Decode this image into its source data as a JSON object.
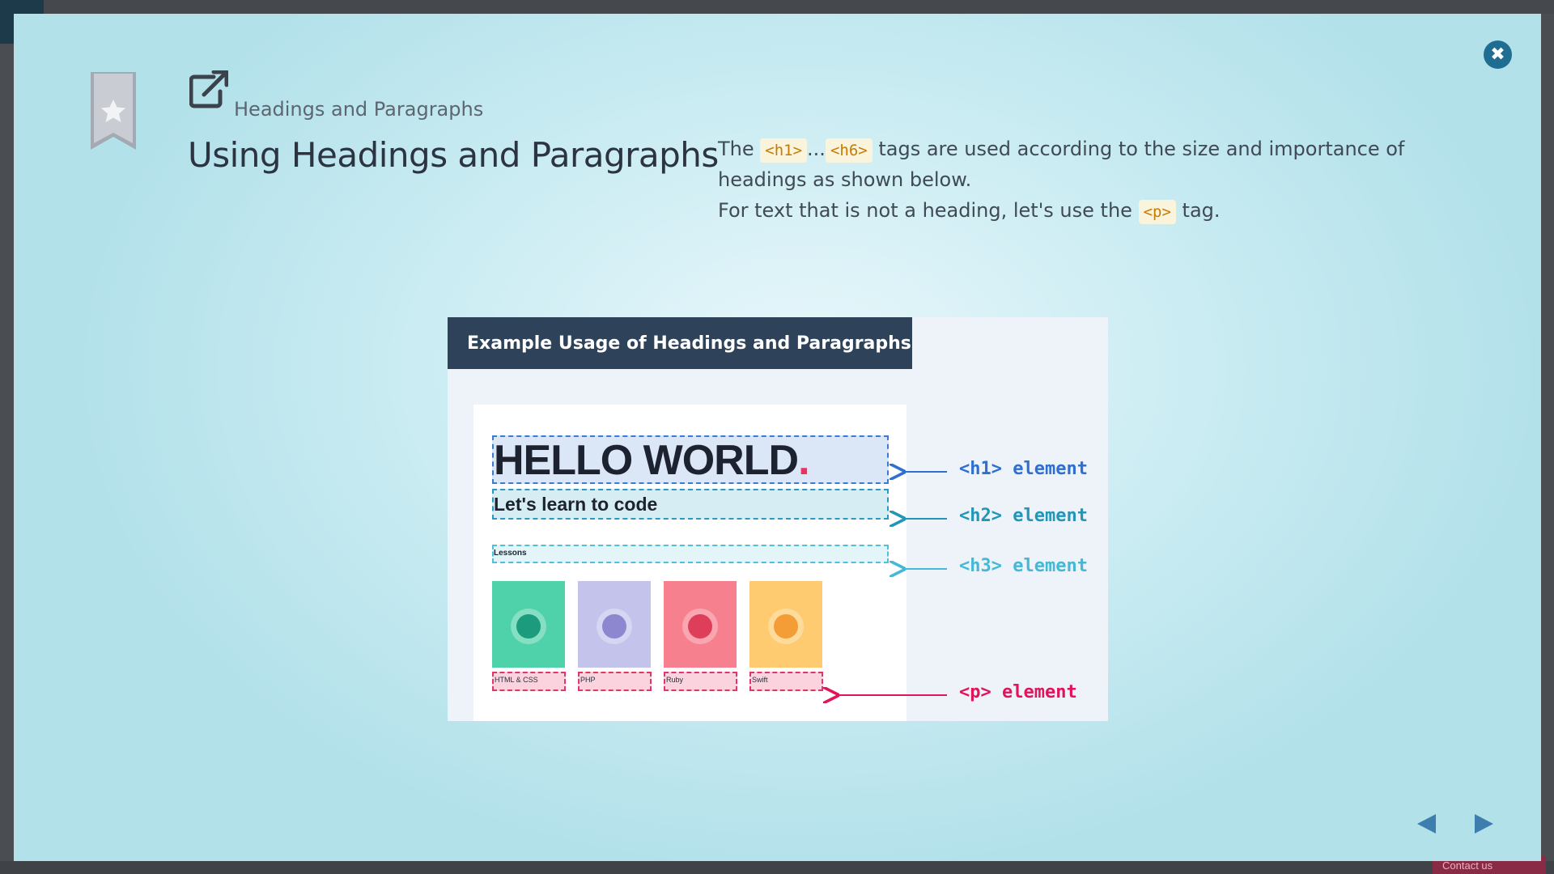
{
  "window": {
    "contact_label": "Contact us"
  },
  "modal": {
    "breadcrumb": "Headings and Paragraphs",
    "title": "Using Headings and Paragraphs",
    "description": {
      "line1_prefix": "The",
      "tag_h1": "<h1>",
      "ellipsis": "...",
      "tag_h6": "<h6>",
      "line1_suffix": "tags are used according to the size and importance of headings as shown below.",
      "line2_prefix": "For text that is not a heading, let's use the",
      "tag_p": "<p>",
      "line2_suffix": "tag."
    },
    "icons": {
      "bookmark": "bookmark-star-icon",
      "external": "external-link-icon",
      "close": "close-icon",
      "prev": "triangle-left-icon",
      "next": "triangle-right-icon"
    }
  },
  "example": {
    "header": "Example Usage of Headings and Paragraphs",
    "mock_h1": "HELLO WORLD",
    "mock_h1_dot": ".",
    "mock_h2": "Let's learn to code",
    "mock_h3": "Lessons",
    "cards": [
      {
        "label": "HTML & CSS",
        "color": "#4fd1a9",
        "icon_color": "#1c9c7c"
      },
      {
        "label": "PHP",
        "color": "#c4c3ec",
        "icon_color": "#8c87cf"
      },
      {
        "label": "Ruby",
        "color": "#f7808e",
        "icon_color": "#df3e5b"
      },
      {
        "label": "Swift",
        "color": "#fecb70",
        "icon_color": "#f49c35"
      }
    ],
    "labels": {
      "h1": "<h1> element",
      "h2": "<h2> element",
      "h3": "<h3> element",
      "p": "<p> element"
    },
    "label_colors": {
      "h1": "#2f6fcf",
      "h2": "#2196b8",
      "h3": "#45b8d6",
      "p": "#e0145a"
    }
  }
}
